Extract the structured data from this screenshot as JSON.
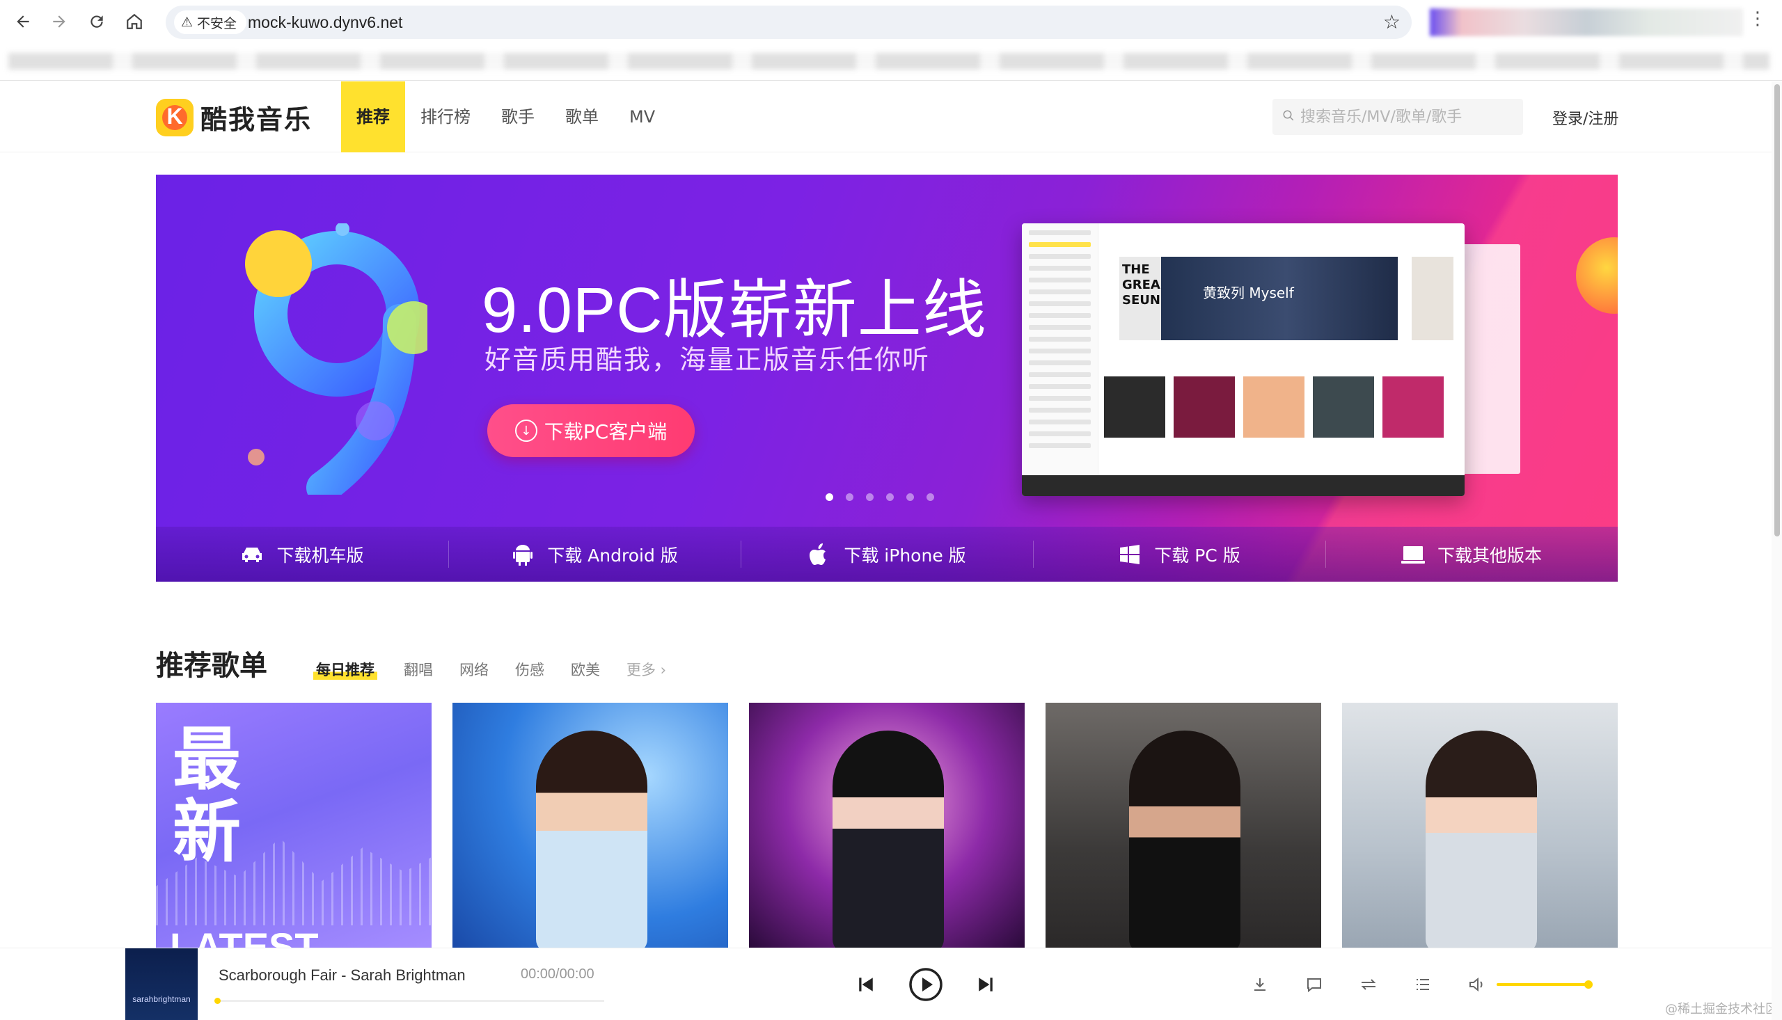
{
  "browser": {
    "security_label": "不安全",
    "url": "mock-kuwo.dynv6.net"
  },
  "site": {
    "logo_text": "酷我音乐",
    "logo_letter": "K",
    "nav": [
      {
        "label": "推荐",
        "active": true
      },
      {
        "label": "排行榜",
        "active": false
      },
      {
        "label": "歌手",
        "active": false
      },
      {
        "label": "歌单",
        "active": false
      },
      {
        "label": "MV",
        "active": false
      }
    ],
    "search_placeholder": "搜索音乐/MV/歌单/歌手",
    "login_label": "登录/注册"
  },
  "banner": {
    "title": "9.0PC版崭新上线",
    "subtitle": "好音质用酷我，海量正版音乐任你听",
    "button_label": "下载PC客户端",
    "dots_total": 6,
    "dot_active_index": 0,
    "mockup_hero_text": "黄致列 Myself",
    "mockup_hero_side_text": "THE GREA SEUN"
  },
  "downloads": [
    {
      "label": "下载机车版",
      "icon": "car-icon"
    },
    {
      "label": "下载 Android 版",
      "icon": "android-icon"
    },
    {
      "label": "下载 iPhone 版",
      "icon": "apple-icon"
    },
    {
      "label": "下载 PC 版",
      "icon": "windows-icon"
    },
    {
      "label": "下载其他版本",
      "icon": "laptop-icon"
    }
  ],
  "playlists": {
    "title": "推荐歌单",
    "tabs": [
      {
        "label": "每日推荐",
        "active": true
      },
      {
        "label": "翻唱",
        "active": false
      },
      {
        "label": "网络",
        "active": false
      },
      {
        "label": "伤感",
        "active": false
      },
      {
        "label": "欧美",
        "active": false
      }
    ],
    "more_label": "更多",
    "cards": [
      {
        "big_text": "最新",
        "caption": "LATEST"
      },
      {
        "caption": ""
      },
      {
        "caption": ""
      },
      {
        "caption": ""
      },
      {
        "caption": ""
      }
    ]
  },
  "player": {
    "album_text": "sarahbrightman",
    "track": "Scarborough Fair - Sarah Brightman",
    "time": "00:00/00:00",
    "progress": 0,
    "volume": 1.0
  },
  "watermark": "@稀土掘金技术社区",
  "colors": {
    "accent": "#ffe12e",
    "banner_start": "#6b22e6",
    "banner_end": "#f02c80"
  }
}
